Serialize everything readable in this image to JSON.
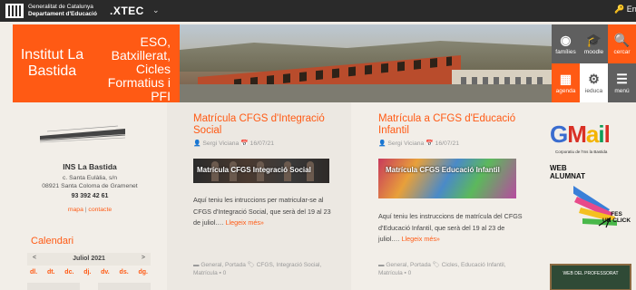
{
  "topbar": {
    "gen_line1": "Generalitat de Catalunya",
    "gen_line2": "Departament d'Educació",
    "xtec": ".XTEC",
    "login": "Entrar"
  },
  "header": {
    "institute": "Institut La Bastida",
    "education": [
      "ESO,",
      "Batxillerat,",
      "Cicles",
      "Formatius i PFI"
    ],
    "tiles": [
      {
        "label": "famílies",
        "icon": "eye-icon"
      },
      {
        "label": "moodle",
        "icon": "graduation-cap-icon"
      },
      {
        "label": "cercar",
        "icon": "search-icon"
      },
      {
        "label": "agenda",
        "icon": "calendar-icon"
      },
      {
        "label": "ieduca",
        "icon": "gear-icon"
      },
      {
        "label": "menú",
        "icon": "menu-icon"
      }
    ]
  },
  "sidebar": {
    "school_name": "INS La Bastida",
    "address_line1": "c. Santa Eulàlia, s/n",
    "address_line2": "08921 Santa Coloma de Gramenet",
    "phone": "93 392 42 61",
    "link_map": "mapa",
    "link_separator": "|",
    "link_contact": "contacte",
    "calendar_title": "Calendari",
    "calendar_month": "Juliol 2021",
    "calendar_prev": "<",
    "calendar_next": ">",
    "weekdays": [
      "dl.",
      "dt.",
      "dc.",
      "dj.",
      "dv.",
      "ds.",
      "dg."
    ]
  },
  "posts": [
    {
      "title": "Matrícula CFGS d'Integració Social",
      "author": "Sergi Viciana",
      "date": "16/07/21",
      "image_caption": "Matrícula CFGS Integració Social",
      "excerpt": "Aquí teniu les intruccions per matricular-se al CFGS d'Integració Social, que serà del 19 al 23 de juliol.… ",
      "more": "Llegeix més»",
      "categories": "General, Portada",
      "tags": "CFGS, Integració Social,",
      "tags2": "Matrícula",
      "comments": "0"
    },
    {
      "title": "Matrícula a CFGS d'Educació Infantil",
      "author": "Sergi Viciana",
      "date": "16/07/21",
      "image_caption": "Matrícula CFGS Educació Infantil",
      "excerpt": "Aquí teniu les instruccions de matrícula del CFGS d'Educació Infantil, que serà del 19 al 23 de juliol.… ",
      "more": "Llegeix més»",
      "categories": "General, Portada",
      "tags": "Cicles, Educació Infantil,",
      "tags2": "Matrícula",
      "comments": "0"
    }
  ],
  "rightcol": {
    "gmail_letters": [
      "G",
      "M",
      "a",
      "i",
      "l"
    ],
    "gmail_sub": "Corporatiu de l'Ins la Bastida",
    "web_alumnat_1": "WEB",
    "web_alumnat_2": "ALUMNAT",
    "fes_1": "FES",
    "fes_2": "UN CLICK",
    "prof": "WEB DEL PROFESSORAT"
  },
  "colors": {
    "accent": "#ff5a14",
    "dark": "#2a2a2a",
    "tile_gray": "#5f5f5f"
  }
}
